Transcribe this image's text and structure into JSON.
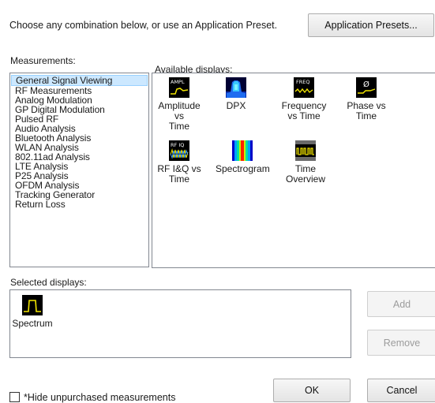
{
  "intro_text": "Choose any combination below, or use an Application Preset.",
  "preset_button": "Application Presets...",
  "measurements_label": "Measurements:",
  "measurements": [
    "General Signal Viewing",
    "RF Measurements",
    "Analog Modulation",
    "GP Digital Modulation",
    "Pulsed RF",
    "Audio Analysis",
    "Bluetooth Analysis",
    "WLAN Analysis",
    "802.11ad Analysis",
    "LTE Analysis",
    "P25 Analysis",
    "OFDM Analysis",
    "Tracking Generator",
    "Return Loss"
  ],
  "selected_measurement": "General Signal Viewing",
  "available_label": "Available displays:",
  "available": [
    {
      "icon": "ampl-icon",
      "icon_text": "AMPL",
      "caption": [
        "Amplitude vs",
        "Time"
      ]
    },
    {
      "icon": "dpx-icon",
      "icon_text": "",
      "caption": [
        "DPX"
      ]
    },
    {
      "icon": "freq-icon",
      "icon_text": "FREQ",
      "caption": [
        "Frequency",
        "vs Time"
      ]
    },
    {
      "icon": "phase-icon",
      "icon_text": "Ø",
      "caption": [
        "Phase vs",
        "Time"
      ]
    },
    {
      "icon": "rfiq-icon",
      "icon_text": "RF IQ",
      "caption": [
        "RF I&Q vs",
        "Time"
      ]
    },
    {
      "icon": "spectrogram-icon",
      "icon_text": "",
      "caption": [
        "Spectrogram"
      ]
    },
    {
      "icon": "time-overview-icon",
      "icon_text": "",
      "caption": [
        "Time",
        "Overview"
      ]
    }
  ],
  "selected_label": "Selected displays:",
  "selected": [
    {
      "icon": "spectrum-icon",
      "caption": "Spectrum"
    }
  ],
  "add_button": "Add",
  "remove_button": "Remove",
  "ok_button": "OK",
  "cancel_button": "Cancel",
  "hide_checkbox_label": "*Hide unpurchased measurements",
  "hide_checked": false,
  "colors": {
    "selection_bg": "#cce8ff",
    "icon_bg": "#000000",
    "trace_yellow": "#f2e600"
  }
}
